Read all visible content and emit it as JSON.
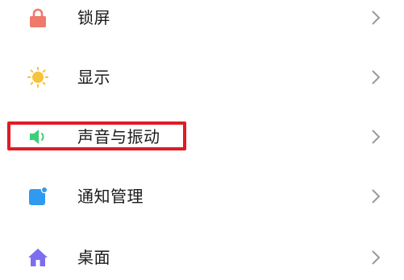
{
  "settings": {
    "items": [
      {
        "label": "锁屏",
        "icon": "lock-icon"
      },
      {
        "label": "显示",
        "icon": "sun-icon"
      },
      {
        "label": "声音与振动",
        "icon": "speaker-icon"
      },
      {
        "label": "通知管理",
        "icon": "notification-icon"
      },
      {
        "label": "桌面",
        "icon": "home-icon"
      }
    ]
  },
  "colors": {
    "lock": "#ef7a6a",
    "sun": "#f7c23c",
    "speaker": "#3ccf78",
    "notification": "#2f9af0",
    "home": "#7b6ef0",
    "chevron": "#9a9a9a",
    "highlight": "#e01b24"
  }
}
